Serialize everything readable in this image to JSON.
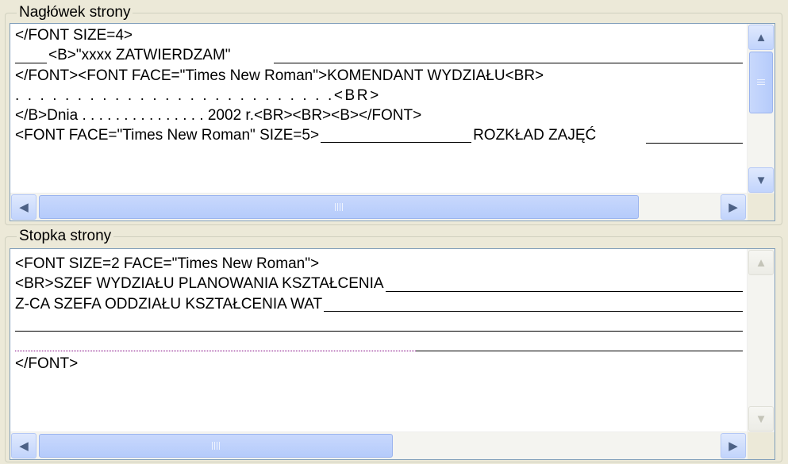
{
  "header_section": {
    "title": "Nagłówek strony",
    "lines": [
      "</FONT SIZE=4>",
      "<B>\"xxxx ZATWIERDZAM\"",
      "</FONT><FONT FACE=\"Times New Roman\">KOMENDANT WYDZIAŁU<BR>",
      ". . . . . . . . . . . . . . . . . . . . . . . . . .<BR>",
      "</B>Dnia . . . . . . . . . . . . . . . 2002 r.<BR><BR><B></FONT>",
      "<FONT FACE=\"Times New Roman\" SIZE=5>",
      "ROZKŁAD ZAJĘĆ"
    ]
  },
  "footer_section": {
    "title": "Stopka strony",
    "lines": [
      "<FONT SIZE=2 FACE=\"Times New Roman\">",
      "<BR>SZEF WYDZIAŁU PLANOWANIA KSZTAŁCENIA",
      "Z-CA SZEFA ODDZIAŁU KSZTAŁCENIA WAT",
      "</FONT>"
    ]
  },
  "icons": {
    "up": "arrow-up-icon",
    "down": "arrow-down-icon",
    "left": "arrow-left-icon",
    "right": "arrow-right-icon"
  }
}
